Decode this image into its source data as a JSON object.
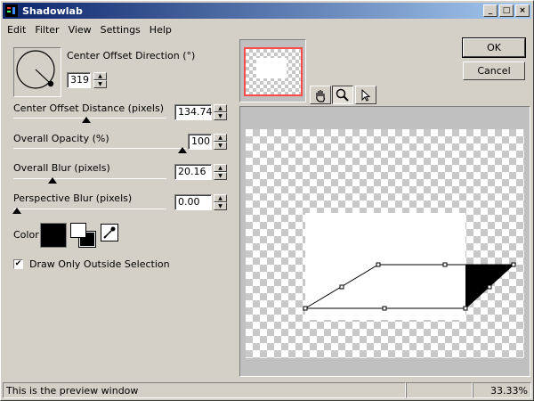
{
  "window": {
    "title": "Shadowlab",
    "minimize": "_",
    "maximize": "□",
    "close": "×"
  },
  "menu": [
    "Edit",
    "Filter",
    "View",
    "Settings",
    "Help"
  ],
  "controls": {
    "direction": {
      "label": "Center Offset Direction (°)",
      "value": "319"
    },
    "distance": {
      "label": "Center Offset Distance (pixels)",
      "value": "134.74"
    },
    "opacity": {
      "label": "Overall Opacity (%)",
      "value": "100"
    },
    "blur": {
      "label": "Overall Blur (pixels)",
      "value": "20.16"
    },
    "perspective_blur": {
      "label": "Perspective Blur (pixels)",
      "value": "0.00"
    },
    "color": {
      "label": "Color",
      "swatch_color": "#000000"
    },
    "draw_outside": {
      "label": "Draw Only Outside Selection",
      "checked": "✔"
    }
  },
  "buttons": {
    "ok": "OK",
    "cancel": "Cancel"
  },
  "tools": [
    "hand-icon",
    "zoom-icon",
    "arrow-icon"
  ],
  "status": {
    "message": "This is the preview window",
    "zoom": "33.33%"
  }
}
